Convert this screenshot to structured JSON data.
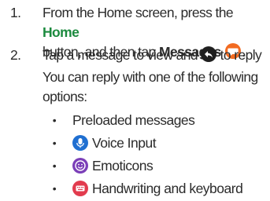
{
  "steps": [
    {
      "number": "1.",
      "line1_prefix": "From the Home screen, press the ",
      "home_label": "Home",
      "line2_prefix": "button, and then tap ",
      "messages_label": "Messages",
      "line2_suffix": ".",
      "icon": "messages-bubble-icon"
    },
    {
      "number": "2.",
      "line1_prefix": "Tap a message to view and ",
      "line1_suffix": " to reply",
      "line2": "You can reply with one of the following",
      "line3": "options:",
      "icon": "reply-arrow-icon"
    }
  ],
  "options": [
    {
      "label": "Preloaded messages",
      "icon": ""
    },
    {
      "label": "Voice Input",
      "icon": "microphone-icon"
    },
    {
      "label": "Emoticons",
      "icon": "smiley-icon"
    },
    {
      "label": "Handwriting and keyboard",
      "icon": "keyboard-icon"
    }
  ],
  "bullet": "•",
  "colors": {
    "accent": "#1b8a3e",
    "messages_icon": "#f26b21",
    "reply_icon": "#1f1f1f",
    "voice_icon": "#1f6fd1",
    "emoticon_icon": "#7b3fb8",
    "keyboard_icon": "#e23b4e"
  }
}
